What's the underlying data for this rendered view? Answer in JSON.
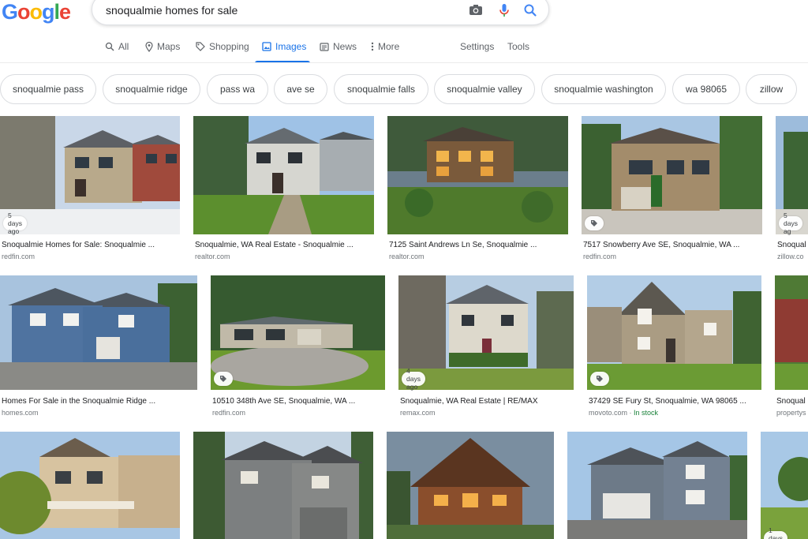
{
  "logo": {
    "letters": [
      "G",
      "o",
      "o",
      "g",
      "l",
      "e"
    ],
    "colors": [
      "#4285f4",
      "#ea4335",
      "#fbbc05",
      "#4285f4",
      "#34a853",
      "#ea4335"
    ]
  },
  "search": {
    "query": "snoqualmie homes for sale",
    "icons": [
      "camera-icon",
      "microphone-icon",
      "search-icon"
    ]
  },
  "tabs": [
    {
      "label": "All",
      "icon": "search-icon"
    },
    {
      "label": "Maps",
      "icon": "map-pin-icon"
    },
    {
      "label": "Shopping",
      "icon": "tag-icon"
    },
    {
      "label": "Images",
      "icon": "image-icon",
      "active": true
    },
    {
      "label": "News",
      "icon": "newspaper-icon"
    },
    {
      "label": "More",
      "icon": "kebab-icon"
    }
  ],
  "tools": {
    "settings": "Settings",
    "tools": "Tools"
  },
  "chips": [
    "snoqualmie pass",
    "snoqualmie ridge",
    "pass wa",
    "ave se",
    "snoqualmie falls",
    "snoqualmie valley",
    "snoqualmie washington",
    "wa 98065",
    "zillow"
  ],
  "results": {
    "row1": [
      {
        "title": "Snoqualmie Homes for Sale: Snoqualmie ...",
        "source": "redfin.com",
        "badge": "5 days ago"
      },
      {
        "title": "Snoqualmie, WA Real Estate - Snoqualmie ...",
        "source": "realtor.com"
      },
      {
        "title": "7125 Saint Andrews Ln Se, Snoqualmie ...",
        "source": "realtor.com"
      },
      {
        "title": "7517 Snowberry Ave SE, Snoqualmie, WA ...",
        "source": "redfin.com",
        "tag": true
      },
      {
        "title": "Snoqual",
        "source": "zillow.co",
        "badge": "5 days ag"
      }
    ],
    "row2": [
      {
        "title": "Homes For Sale in the Snoqualmie Ridge ...",
        "source": "homes.com"
      },
      {
        "title": "10510 348th Ave SE, Snoqualmie, WA ...",
        "source": "redfin.com",
        "tag": true
      },
      {
        "title": "Snoqualmie, WA Real Estate | RE/MAX",
        "source": "remax.com",
        "badge": "4 days ago"
      },
      {
        "title": "37429 SE Fury St, Snoqualmie, WA 98065 ...",
        "source": "movoto.com",
        "stock": "In stock",
        "tag": true
      },
      {
        "title": "Snoqual",
        "source": "propertys"
      }
    ],
    "row3": [
      {
        "title": "",
        "source": ""
      },
      {
        "title": "",
        "source": ""
      },
      {
        "title": "",
        "source": ""
      },
      {
        "title": "",
        "source": ""
      },
      {
        "title": "",
        "source": "",
        "badge": "1 days ago"
      }
    ]
  }
}
